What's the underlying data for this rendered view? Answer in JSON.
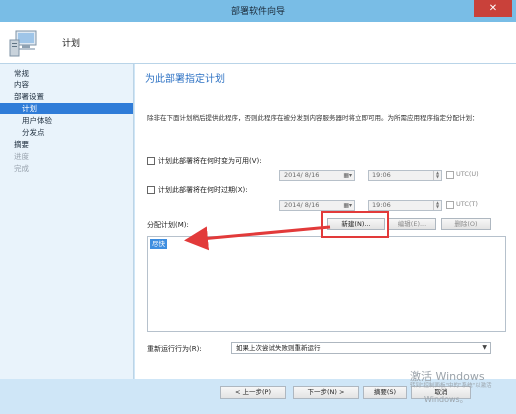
{
  "window": {
    "title": "部署软件向导",
    "close_glyph": "✕"
  },
  "header": {
    "title": "计划",
    "icon": "computer-icon"
  },
  "sidebar": {
    "items": [
      {
        "label": "常规",
        "state": "normal"
      },
      {
        "label": "内容",
        "state": "normal"
      },
      {
        "label": "部署设置",
        "state": "normal"
      },
      {
        "label": "计划",
        "state": "selected"
      },
      {
        "label": "用户体验",
        "state": "normal"
      },
      {
        "label": "分发点",
        "state": "normal"
      },
      {
        "label": "摘要",
        "state": "normal"
      },
      {
        "label": "进度",
        "state": "disabled"
      },
      {
        "label": "完成",
        "state": "disabled"
      }
    ]
  },
  "main": {
    "title": "为此部署指定计划",
    "description": "除非在下面计划稍后提供此程序，否则此程序在被分发到内容服务器时将立即可用。为所需应用程序指定分配计划：",
    "available": {
      "label": "计划此部署将在何时变为可用(V):",
      "checked": false,
      "date": "2014/ 8/16",
      "time": "19:06",
      "utc_label": "UTC(U)"
    },
    "expire": {
      "label": "计划此部署将在何时过期(X):",
      "checked": false,
      "date": "2014/ 8/16",
      "time": "19:06",
      "utc_label": "UTC(T)"
    },
    "schedule": {
      "label": "分配计划(M):",
      "new_button": "新建(N)...",
      "edit_button": "编辑(E)...",
      "delete_button": "删除(O)",
      "items": [
        "尽快"
      ]
    },
    "rerun": {
      "label": "重新运行行为(R):",
      "value": "如果上次尝试失败则重新运行"
    }
  },
  "footer": {
    "prev": "< 上一步(P)",
    "next": "下一步(N) >",
    "summary": "摘要(S)",
    "cancel": "取消"
  },
  "watermark": {
    "title": "激活 Windows",
    "sub": "转到\"控制面板\"中的\"系统\"以激活",
    "sub2": "Windows。"
  },
  "colors": {
    "accent": "#2f7cd8",
    "highlight_red": "#e23a3a",
    "titlebar": "#79bde6"
  }
}
